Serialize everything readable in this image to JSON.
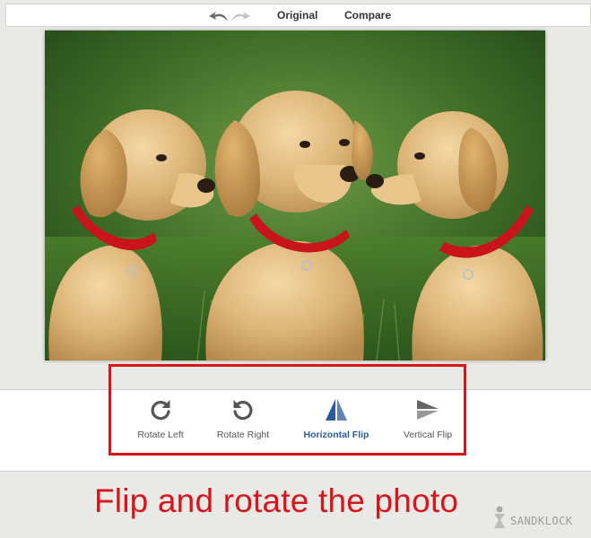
{
  "toolbar": {
    "undo_icon": "undo-icon",
    "redo_icon": "redo-icon",
    "original_label": "Original",
    "compare_label": "Compare"
  },
  "photo": {
    "subject": "three golden retriever puppies"
  },
  "tools": [
    {
      "label": "Rotate Left",
      "icon": "rotate-left-icon",
      "active": false
    },
    {
      "label": "Rotate Right",
      "icon": "rotate-right-icon",
      "active": false
    },
    {
      "label": "Horizontal Flip",
      "icon": "horizontal-flip-icon",
      "active": true
    },
    {
      "label": "Vertical Flip",
      "icon": "vertical-flip-icon",
      "active": false
    }
  ],
  "caption": {
    "text": "Flip and rotate the photo"
  },
  "watermark": {
    "text": "SANDKLOCK"
  },
  "colors": {
    "accent_red": "#d8151b",
    "active_blue": "#2a5b9b",
    "background": "#e9e9e6"
  }
}
